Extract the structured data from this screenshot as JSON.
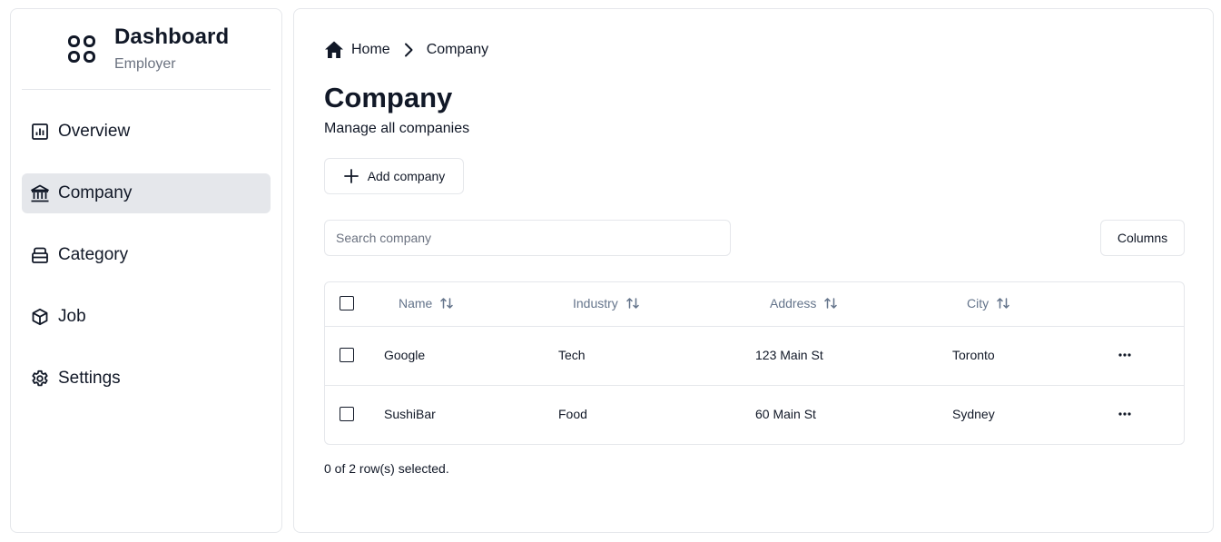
{
  "sidebar": {
    "brand": {
      "title": "Dashboard",
      "subtitle": "Employer",
      "icon": "apps-grid-icon"
    },
    "items": [
      {
        "label": "Overview",
        "icon": "chart-icon",
        "active": false
      },
      {
        "label": "Company",
        "icon": "bank-icon",
        "active": true
      },
      {
        "label": "Category",
        "icon": "drawer-icon",
        "active": false
      },
      {
        "label": "Job",
        "icon": "package-icon",
        "active": false
      },
      {
        "label": "Settings",
        "icon": "gear-icon",
        "active": false
      }
    ]
  },
  "breadcrumb": {
    "home": "Home",
    "current": "Company"
  },
  "page": {
    "title": "Company",
    "subtitle": "Manage all companies",
    "add_label": "Add company"
  },
  "search": {
    "placeholder": "Search company",
    "value": ""
  },
  "columns_button": "Columns",
  "table": {
    "headers": [
      "Name",
      "Industry",
      "Address",
      "City"
    ],
    "rows": [
      {
        "name": "Google",
        "industry": "Tech",
        "address": "123 Main St",
        "city": "Toronto"
      },
      {
        "name": "SushiBar",
        "industry": "Food",
        "address": "60 Main St",
        "city": "Sydney"
      }
    ]
  },
  "status": "0 of 2 row(s) selected.",
  "colors": {
    "active_bg": "#e5e7eb",
    "border": "#e5e7eb",
    "muted": "#6b7280",
    "header_text": "#64748b"
  }
}
